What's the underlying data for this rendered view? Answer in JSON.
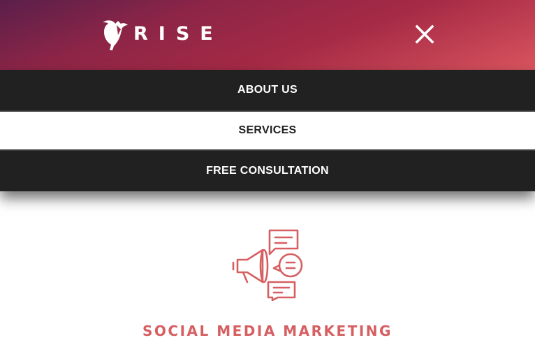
{
  "header": {
    "brand": "RISE",
    "logo_icon": "bird-logo-icon",
    "close_icon": "close-icon"
  },
  "menu": {
    "items": [
      {
        "label": "ABOUT US",
        "active": false
      },
      {
        "label": "SERVICES",
        "active": true
      },
      {
        "label": "FREE CONSULTATION",
        "active": false
      }
    ]
  },
  "service": {
    "icon": "megaphone-chat-icon",
    "title": "SOCIAL MEDIA MARKETING"
  },
  "colors": {
    "accent": "#d65f62",
    "menu_dark": "#212121",
    "header_gradient_start": "#5a1f4a",
    "header_gradient_end": "#d9545e"
  }
}
